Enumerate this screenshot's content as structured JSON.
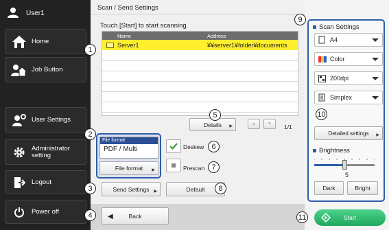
{
  "sidebar": {
    "user": "User1",
    "items": [
      {
        "label": "Home",
        "icon": "home-icon"
      },
      {
        "label": "Job Button",
        "icon": "job-button-icon"
      },
      {
        "label": "User Settings",
        "icon": "user-settings-icon"
      },
      {
        "label": "Administrator setting",
        "icon": "admin-gear-icon"
      },
      {
        "label": "Logout",
        "icon": "logout-icon"
      },
      {
        "label": "Power off",
        "icon": "power-icon"
      }
    ]
  },
  "main": {
    "title": "Scan / Send Settings",
    "instruction": "Touch [Start] to start scanning.",
    "list": {
      "columns": {
        "name": "Name",
        "address": "Address"
      },
      "rows": [
        {
          "name": "Server1",
          "address": "¥¥server1¥folder¥documents"
        }
      ]
    },
    "details_label": "Details",
    "page_indicator": "1/1",
    "file_format": {
      "caption": "File format",
      "value": "PDF / Multi",
      "button": "File format"
    },
    "deskew": {
      "label": "Deskew",
      "checked": true
    },
    "prescan": {
      "label": "Prescan",
      "checked": false
    },
    "send_settings_label": "Send Settings",
    "default_label": "Default",
    "back_label": "Back"
  },
  "scan_settings": {
    "title": "Scan Settings",
    "paper_size": "A4",
    "color_mode": "Color",
    "resolution": "200dpi",
    "sides": "Simplex",
    "detailed_label": "Detailed settings"
  },
  "brightness": {
    "title": "Brightness",
    "value": "5",
    "level": 5,
    "min": 1,
    "max": 9,
    "dark_label": "Dark",
    "bright_label": "Bright"
  },
  "start_label": "Start",
  "callouts": [
    "1",
    "2",
    "3",
    "4",
    "5",
    "6",
    "7",
    "8",
    "9",
    "10",
    "11"
  ],
  "colors": {
    "accent": "#2e5da8",
    "selected_row": "#ffef2f",
    "start_green": "#1fa85e",
    "sidebar_bg": "#222222"
  }
}
